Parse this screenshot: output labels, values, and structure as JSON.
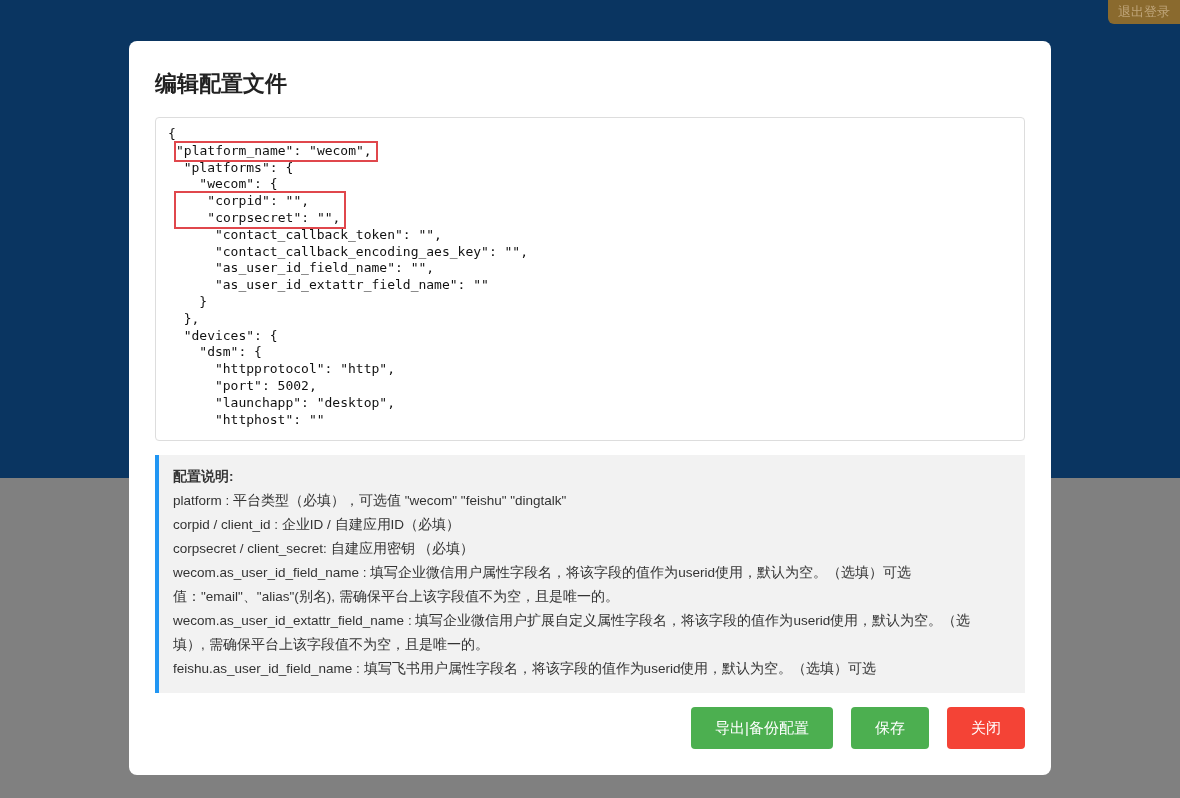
{
  "header": {
    "logout_button": "退出登录"
  },
  "dialog": {
    "title": "编辑配置文件",
    "editor": {
      "lines": [
        {
          "text": "{",
          "highlighted": false
        },
        {
          "text": "  \"platform_name\": \"wecom\",",
          "highlighted": true
        },
        {
          "text": "  \"platforms\": {",
          "highlighted": false
        },
        {
          "text": "    \"wecom\": {",
          "highlighted": false
        },
        {
          "text": "      \"corpid\": \"\",",
          "highlighted": true
        },
        {
          "text": "      \"corpsecret\": \"\",",
          "highlighted": true
        },
        {
          "text": "      \"contact_callback_token\": \"\",",
          "highlighted": false
        },
        {
          "text": "      \"contact_callback_encoding_aes_key\": \"\",",
          "highlighted": false
        },
        {
          "text": "      \"as_user_id_field_name\": \"\",",
          "highlighted": false
        },
        {
          "text": "      \"as_user_id_extattr_field_name\": \"\"",
          "highlighted": false
        },
        {
          "text": "    }",
          "highlighted": false
        },
        {
          "text": "  },",
          "highlighted": false
        },
        {
          "text": "  \"devices\": {",
          "highlighted": false
        },
        {
          "text": "    \"dsm\": {",
          "highlighted": false
        },
        {
          "text": "      \"httpprotocol\": \"http\",",
          "highlighted": false
        },
        {
          "text": "      \"port\": 5002,",
          "highlighted": false
        },
        {
          "text": "      \"launchapp\": \"desktop\",",
          "highlighted": false
        },
        {
          "text": "      \"httphost\": \"\"",
          "highlighted": false
        }
      ]
    },
    "notes": {
      "title": "配置说明:",
      "items": [
        "platform : 平台类型（必填），可选值 \"wecom\" \"feishu\" \"dingtalk\"",
        "corpid / client_id : 企业ID / 自建应用ID（必填）",
        "corpsecret / client_secret: 自建应用密钥 （必填）",
        "wecom.as_user_id_field_name : 填写企业微信用户属性字段名，将该字段的值作为userid使用，默认为空。（选填）可选值：\"email\"、\"alias\"(别名), 需确保平台上该字段值不为空，且是唯一的。",
        "wecom.as_user_id_extattr_field_name : 填写企业微信用户扩展自定义属性字段名，将该字段的值作为userid使用，默认为空。（选填）, 需确保平台上该字段值不为空，且是唯一的。",
        "feishu.as_user_id_field_name : 填写飞书用户属性字段名，将该字段的值作为userid使用，默认为空。（选填）可选"
      ]
    },
    "buttons": [
      {
        "label": "导出|备份配置",
        "kind": "primary"
      },
      {
        "label": "保存",
        "kind": "primary"
      },
      {
        "label": "关闭",
        "kind": "danger"
      }
    ]
  }
}
